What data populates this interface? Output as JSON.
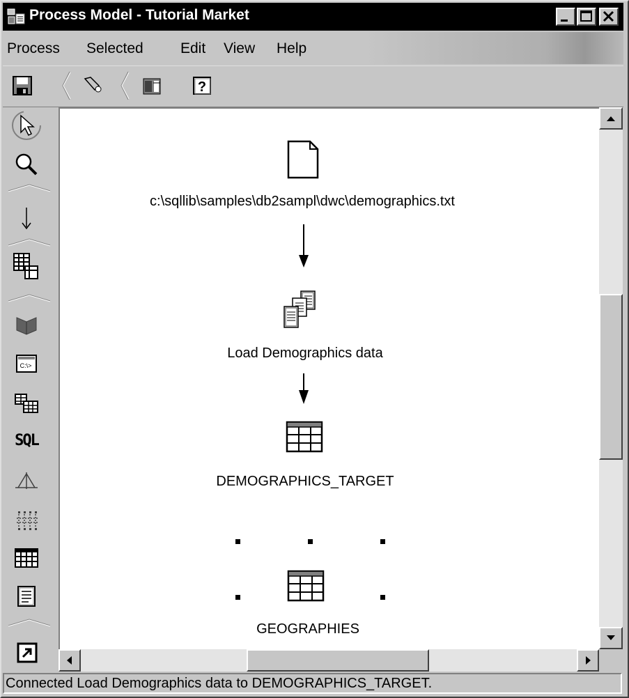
{
  "window": {
    "title": "Process Model - Tutorial Market"
  },
  "menu": {
    "items": [
      "Process",
      "Selected",
      "Edit",
      "View",
      "Help"
    ]
  },
  "toolbar": {
    "buttons": [
      "save-icon",
      "flashlight-icon",
      "object-icon",
      "help-icon"
    ]
  },
  "palette": {
    "tools": [
      "select-arrow-icon",
      "zoom-icon",
      "link-arrow-icon",
      "source-tables-icon",
      "program-icon",
      "command-icon",
      "steps-icon",
      "sql-icon",
      "transformer-icon",
      "grid-icon",
      "table-icon",
      "file-icon",
      "shortcut-icon"
    ],
    "sql_label": "SQL"
  },
  "canvas": {
    "nodes": [
      {
        "label": "c:\\sqllib\\samples\\db2sampl\\dwc\\demographics.txt",
        "icon": "file-icon"
      },
      {
        "label": "Load Demographics data",
        "icon": "step-documents-icon"
      },
      {
        "label": "DEMOGRAPHICS_TARGET",
        "icon": "table-icon"
      },
      {
        "label": "GEOGRAPHIES",
        "icon": "table-icon",
        "selected": true
      }
    ]
  },
  "status": {
    "text": "Connected Load Demographics data to DEMOGRAPHICS_TARGET."
  }
}
